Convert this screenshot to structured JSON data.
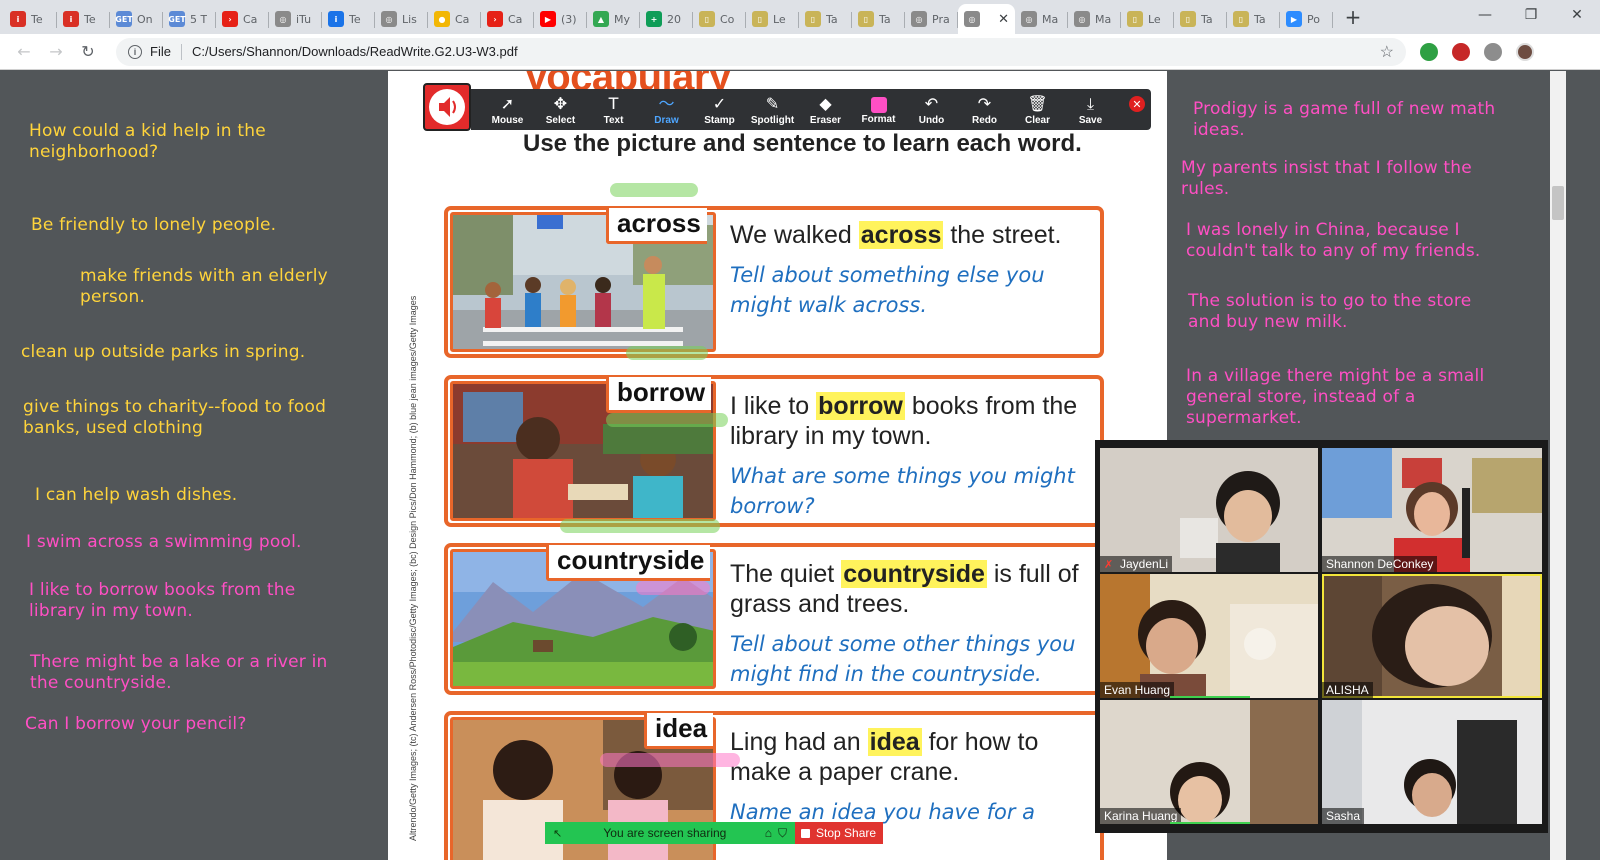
{
  "browser": {
    "tabs": [
      {
        "title": "Te",
        "favicon": "#d93025",
        "glyph": "i",
        "active": false
      },
      {
        "title": "Te",
        "favicon": "#d93025",
        "glyph": "i",
        "active": false
      },
      {
        "title": "On",
        "favicon": "#5c8ad6",
        "glyph": "GET",
        "active": false
      },
      {
        "title": "5 T",
        "favicon": "#5c8ad6",
        "glyph": "GET",
        "active": false
      },
      {
        "title": "Ca",
        "favicon": "#e62117",
        "glyph": "›",
        "active": false
      },
      {
        "title": "iTu",
        "favicon": "#8a8a8a",
        "glyph": "◎",
        "active": false
      },
      {
        "title": "Te",
        "favicon": "#1a73e8",
        "glyph": "i",
        "active": false
      },
      {
        "title": "Lis",
        "favicon": "#8a8a8a",
        "glyph": "◎",
        "active": false
      },
      {
        "title": "Ca",
        "favicon": "#f2b705",
        "glyph": "●",
        "active": false
      },
      {
        "title": "Ca",
        "favicon": "#e62117",
        "glyph": "›",
        "active": false
      },
      {
        "title": "(3)",
        "favicon": "#ff0000",
        "glyph": "▶",
        "active": false
      },
      {
        "title": "My",
        "favicon": "#34a853",
        "glyph": "▲",
        "active": false
      },
      {
        "title": "20",
        "favicon": "#0f9d58",
        "glyph": "+",
        "active": false
      },
      {
        "title": "Co",
        "favicon": "#c9b458",
        "glyph": "▯",
        "active": false
      },
      {
        "title": "Le",
        "favicon": "#c9b458",
        "glyph": "▯",
        "active": false
      },
      {
        "title": "Ta",
        "favicon": "#c9b458",
        "glyph": "▯",
        "active": false
      },
      {
        "title": "Ta",
        "favicon": "#c9b458",
        "glyph": "▯",
        "active": false
      },
      {
        "title": "Pra",
        "favicon": "#8a8a8a",
        "glyph": "◎",
        "active": false
      },
      {
        "title": "",
        "favicon": "#8a8a8a",
        "glyph": "◎",
        "active": true
      },
      {
        "title": "Ma",
        "favicon": "#8a8a8a",
        "glyph": "◎",
        "active": false
      },
      {
        "title": "Ma",
        "favicon": "#8a8a8a",
        "glyph": "◎",
        "active": false
      },
      {
        "title": "Le",
        "favicon": "#c9b458",
        "glyph": "▯",
        "active": false
      },
      {
        "title": "Ta",
        "favicon": "#c9b458",
        "glyph": "▯",
        "active": false
      },
      {
        "title": "Ta",
        "favicon": "#c9b458",
        "glyph": "▯",
        "active": false
      },
      {
        "title": "Po",
        "favicon": "#2d8cff",
        "glyph": "▶",
        "active": false
      }
    ],
    "address": {
      "scheme_label": "File",
      "path": "C:/Users/Shannon/Downloads/ReadWrite.G2.U3-W3.pdf"
    }
  },
  "left_notes": [
    {
      "text": "How could a kid help in the neighborhood?",
      "color": "yellow"
    },
    {
      "text": "Be friendly to lonely people.",
      "color": "yellow"
    },
    {
      "text": "make friends with an elderly person.",
      "color": "yellow"
    },
    {
      "text": "clean up outside parks in spring.",
      "color": "yellow"
    },
    {
      "text": "give things to charity--food to food banks, used clothing",
      "color": "yellow"
    },
    {
      "text": "I can help wash dishes.",
      "color": "yellow"
    },
    {
      "text": "I swim across a swimming pool.",
      "color": "pink"
    },
    {
      "text": "I like to borrow books from the library in my town.",
      "color": "pink"
    },
    {
      "text": "There might be a lake or a river in the countryside.",
      "color": "pink"
    },
    {
      "text": "Can I borrow your pencil?",
      "color": "pink"
    }
  ],
  "right_notes": [
    {
      "text": "Prodigy is a game full of new math ideas.",
      "color": "pink"
    },
    {
      "text": "My parents insist that I follow the rules.",
      "color": "pink"
    },
    {
      "text": "I was lonely in China, because I couldn't talk to any of my friends.",
      "color": "pink"
    },
    {
      "text": "The solution is to go to the store and buy new milk.",
      "color": "pink"
    },
    {
      "text": "In a village there might be a small general store, instead of a supermarket.",
      "color": "pink"
    }
  ],
  "pdf": {
    "title": "Vocabulary",
    "instruction": "Use the picture and sentence to learn each word.",
    "photo_credit": "Altrendo/Getty Images; (tc) Andersen Ross/Photodisc/Getty Images; (bc) Design Pics/Don Hammond; (b) blue jean images/Getty Images",
    "cards": [
      {
        "word": "across",
        "sentence_before": "We walked ",
        "sentence_word": "across",
        "sentence_after": " the street.",
        "prompt": "Tell about something else you might walk across."
      },
      {
        "word": "borrow",
        "sentence_before": "I like to ",
        "sentence_word": "borrow",
        "sentence_after": " books from the library in my town.",
        "prompt": "What are some things you might borrow?"
      },
      {
        "word": "countryside",
        "sentence_before": "The quiet ",
        "sentence_word": "countryside",
        "sentence_after": " is full of grass and trees.",
        "prompt": "Tell about some other things you might find in the countryside."
      },
      {
        "word": "idea",
        "sentence_before": "Ling had an ",
        "sentence_word": "idea",
        "sentence_after": " for how to make a paper crane.",
        "prompt": "Name an idea you have for a"
      }
    ]
  },
  "annotation_toolbar": {
    "tools": [
      {
        "label": "Mouse",
        "icon": "mouse-icon",
        "glyph": "➚"
      },
      {
        "label": "Select",
        "icon": "select-icon",
        "glyph": "✥"
      },
      {
        "label": "Text",
        "icon": "text-icon",
        "glyph": "T"
      },
      {
        "label": "Draw",
        "icon": "draw-icon",
        "glyph": "〜"
      },
      {
        "label": "Stamp",
        "icon": "stamp-icon",
        "glyph": "✓"
      },
      {
        "label": "Spotlight",
        "icon": "spotlight-icon",
        "glyph": "✎"
      },
      {
        "label": "Eraser",
        "icon": "eraser-icon",
        "glyph": "◆"
      },
      {
        "label": "Format",
        "icon": "format-icon",
        "glyph": ""
      },
      {
        "label": "Undo",
        "icon": "undo-icon",
        "glyph": "↶"
      },
      {
        "label": "Redo",
        "icon": "redo-icon",
        "glyph": "↷"
      },
      {
        "label": "Clear",
        "icon": "clear-icon",
        "glyph": "🗑"
      },
      {
        "label": "Save",
        "icon": "save-icon",
        "glyph": "⤓"
      }
    ],
    "active_tool": "Draw",
    "format_color": "#ff4fc4"
  },
  "share_bar": {
    "message": "You are screen sharing",
    "stop_label": "Stop Share"
  },
  "participants": [
    {
      "name": "JaydenLi",
      "muted": true,
      "speaking": false
    },
    {
      "name": "Shannon DeConkey",
      "muted": false,
      "speaking": false
    },
    {
      "name": "Evan Huang",
      "muted": false,
      "speaking": false
    },
    {
      "name": "ALISHA",
      "muted": false,
      "speaking": true
    },
    {
      "name": "Karina Huang",
      "muted": false,
      "speaking": false
    },
    {
      "name": "Sasha",
      "muted": false,
      "speaking": false
    }
  ]
}
